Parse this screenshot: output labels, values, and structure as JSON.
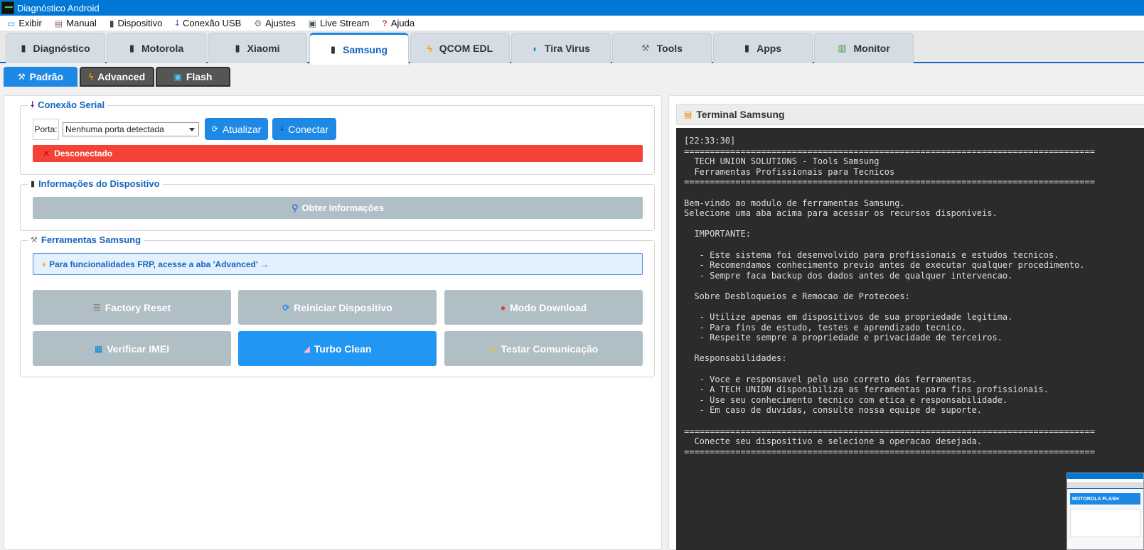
{
  "window": {
    "title": "Diagnóstico Android"
  },
  "menu": {
    "items": [
      {
        "label": "Exibir",
        "icon": "monitor-icon"
      },
      {
        "label": "Manual",
        "icon": "book-icon"
      },
      {
        "label": "Dispositivo",
        "icon": "phone-icon"
      },
      {
        "label": "Conexão USB",
        "icon": "usb-plug-icon"
      },
      {
        "label": "Ajustes",
        "icon": "gear-icon"
      },
      {
        "label": "Live Stream",
        "icon": "tram-icon"
      },
      {
        "label": "Ajuda",
        "icon": "question-icon"
      }
    ]
  },
  "main_tabs": {
    "items": [
      {
        "label": "Diagnóstico",
        "icon": "phone-icon"
      },
      {
        "label": "Motorola",
        "icon": "phone-icon"
      },
      {
        "label": "Xiaomi",
        "icon": "phone-icon"
      },
      {
        "label": "Samsung",
        "icon": "phone-icon"
      },
      {
        "label": "QCOM EDL",
        "icon": "lightning-icon"
      },
      {
        "label": "Tira Virus",
        "icon": "pill-icon"
      },
      {
        "label": "Tools",
        "icon": "wrench-icon"
      },
      {
        "label": "Apps",
        "icon": "phone-icon"
      },
      {
        "label": "Monitor",
        "icon": "bar-chart-icon"
      }
    ],
    "active": "Samsung"
  },
  "sub_tabs": {
    "items": [
      {
        "label": "Padrão",
        "icon": "wrench-icon"
      },
      {
        "label": "Advanced",
        "icon": "lightning-icon"
      },
      {
        "label": "Flash",
        "icon": "flash-box-icon"
      }
    ],
    "active": "Padrão"
  },
  "serial": {
    "title": "Conexão Serial",
    "port_label": "Porta:",
    "port_value": "Nenhuma porta detectada",
    "refresh_label": "Atualizar",
    "connect_label": "Conectar",
    "status": "Desconectado",
    "status_color": "#f44336"
  },
  "device_info": {
    "title": "Informações do Dispositivo",
    "get_info_label": "Obter Informações"
  },
  "tools": {
    "title": "Ferramentas Samsung",
    "frp_notice": "Para funcionalidades FRP, acesse a aba 'Advanced' →",
    "buttons": [
      {
        "label": "Factory Reset",
        "icon": "broom-icon"
      },
      {
        "label": "Reiniciar Dispositivo",
        "icon": "refresh-icon"
      },
      {
        "label": "Modo Download",
        "icon": "joystick-icon"
      },
      {
        "label": "Verificar IMEI",
        "icon": "grid-icon"
      },
      {
        "label": "Turbo Clean",
        "icon": "eraser-icon"
      },
      {
        "label": "Testar Comunicação",
        "icon": "warning-icon"
      }
    ],
    "accent_color": "#2196f3",
    "disabled_color": "#b0bec5"
  },
  "terminal": {
    "title": "Terminal Samsung",
    "lines": [
      "[22:33:30]",
      "================================================================================",
      "  TECH UNION SOLUTIONS - Tools Samsung",
      "  Ferramentas Profissionais para Tecnicos",
      "================================================================================",
      "",
      "Bem-vindo ao modulo de ferramentas Samsung.",
      "Selecione uma aba acima para acessar os recursos disponiveis.",
      "",
      "  IMPORTANTE:",
      "",
      "   - Este sistema foi desenvolvido para profissionais e estudos tecnicos.",
      "   - Recomendamos conhecimento previo antes de executar qualquer procedimento.",
      "   - Sempre faca backup dos dados antes de qualquer intervencao.",
      "",
      "  Sobre Desbloqueios e Remocao de Protecoes:",
      "",
      "   - Utilize apenas em dispositivos de sua propriedade legitima.",
      "   - Para fins de estudo, testes e aprendizado tecnico.",
      "   - Respeite sempre a propriedade e privacidade de terceiros.",
      "",
      "  Responsabilidades:",
      "",
      "   - Voce e responsavel pelo uso correto das ferramentas.",
      "   - A TECH UNION disponibiliza as ferramentas para fins profissionais.",
      "   - Use seu conhecimento tecnico com etica e responsabilidade.",
      "   - Em caso de duvidas, consulte nossa equipe de suporte.",
      "",
      "================================================================================",
      "  Conecte seu dispositivo e selecione a operacao desejada.",
      "================================================================================"
    ]
  },
  "thumbnail": {
    "label": "MOTOROLA FLASH"
  }
}
